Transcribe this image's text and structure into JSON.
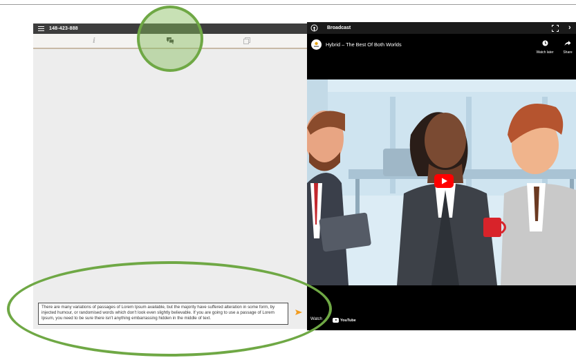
{
  "chat_panel": {
    "meeting_id": "148-423-888",
    "tabs": [
      {
        "name": "info",
        "icon": "info-icon"
      },
      {
        "name": "chat",
        "icon": "chat-icon",
        "active": true
      },
      {
        "name": "documents",
        "icon": "documents-icon"
      }
    ],
    "message_input": {
      "value": "There are many variations of passages of Lorem Ipsum available, but the majority have suffered alteration in some form, by injected humour, or randomised words which don't look even slightly believable. If you are going to use a passage of Lorem Ipsum, you need to be sure there isn't anything embarrassing hidden in the middle of text."
    },
    "send_icon": "send-icon"
  },
  "broadcast": {
    "label": "Broadcast",
    "video_title": "Hybrid – The Best Of Both Worlds",
    "watch_later_label": "Watch later",
    "share_label": "Share",
    "watch_on_label": "Watch",
    "youtube_label": "YouTube"
  },
  "colors": {
    "header_bg": "#3d3d3d",
    "chat_bg": "#ededed",
    "tab_underline": "#c8b9a6",
    "send_accent": "#f29b1d",
    "highlight_green": "#6fa845",
    "youtube_red": "#ff0000"
  }
}
